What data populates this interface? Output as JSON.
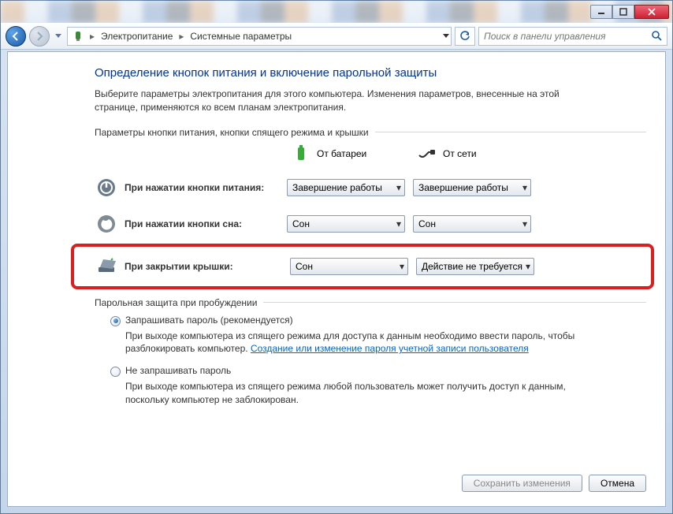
{
  "breadcrumb": {
    "items": [
      "Электропитание",
      "Системные параметры"
    ]
  },
  "search": {
    "placeholder": "Поиск в панели управления"
  },
  "page": {
    "title": "Определение кнопок питания и включение парольной защиты",
    "description": "Выберите параметры электропитания для этого компьютера. Изменения параметров, внесенные на этой странице, применяются ко всем планам электропитания."
  },
  "buttons_section": {
    "legend": "Параметры кнопки питания, кнопки спящего режима и крышки",
    "col_battery": "От батареи",
    "col_plugged": "От сети",
    "rows": [
      {
        "label": "При нажатии кнопки питания:",
        "battery": "Завершение работы",
        "plugged": "Завершение работы"
      },
      {
        "label": "При нажатии кнопки сна:",
        "battery": "Сон",
        "plugged": "Сон"
      },
      {
        "label": "При закрытии крышки:",
        "battery": "Сон",
        "plugged": "Действие не требуется"
      }
    ]
  },
  "password_section": {
    "legend": "Парольная защита при пробуждении",
    "option1_label": "Запрашивать пароль (рекомендуется)",
    "option1_desc_a": "При выходе компьютера из спящего режима для доступа к данным необходимо ввести пароль, чтобы разблокировать компьютер. ",
    "option1_link": "Создание или изменение пароля учетной записи пользователя",
    "option2_label": "Не запрашивать пароль",
    "option2_desc": "При выходе компьютера из спящего режима любой пользователь может получить доступ к данным, поскольку компьютер не заблокирован."
  },
  "footer": {
    "save": "Сохранить изменения",
    "cancel": "Отмена"
  }
}
